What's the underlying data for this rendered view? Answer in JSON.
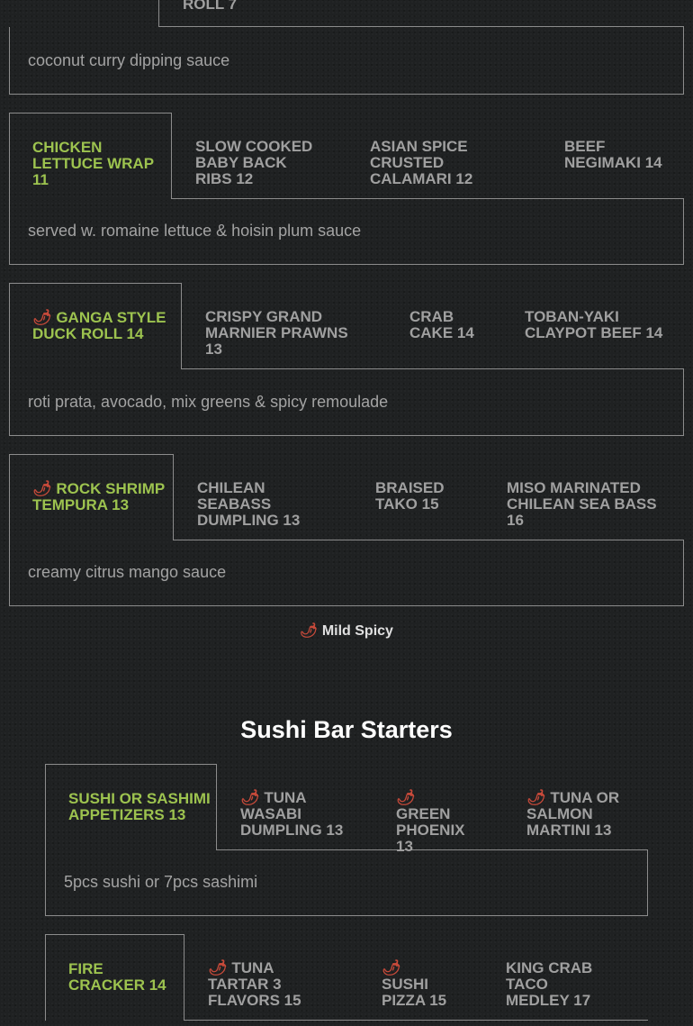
{
  "group0": {
    "tab_label": "ROLL 7",
    "description": "coconut curry dipping sauce"
  },
  "group1": {
    "tabs": [
      {
        "label": "CHICKEN LETTUCE WRAP 11",
        "active": true
      },
      {
        "label": "SLOW COOKED BABY BACK RIBS 12",
        "active": false
      },
      {
        "label": "ASIAN SPICE CRUSTED CALAMARI 12",
        "active": false
      },
      {
        "label": "BEEF NEGIMAKI 14",
        "active": false
      }
    ],
    "description": "served w. romaine lettuce & hoisin plum sauce"
  },
  "group2": {
    "tabs": [
      {
        "label": "GANGA STYLE DUCK ROLL 14",
        "active": true,
        "spicy": true
      },
      {
        "label": "CRISPY GRAND MARNIER PRAWNS 13",
        "active": false
      },
      {
        "label": "CRAB CAKE 14",
        "active": false
      },
      {
        "label": "TOBAN-YAKI CLAYPOT BEEF 14",
        "active": false
      }
    ],
    "description": "roti prata, avocado, mix greens & spicy remoulade"
  },
  "group3": {
    "tabs": [
      {
        "label": "ROCK SHRIMP TEMPURA 13",
        "active": true,
        "spicy": true
      },
      {
        "label": "CHILEAN SEABASS DUMPLING 13",
        "active": false
      },
      {
        "label": "BRAISED TAKO 15",
        "active": false
      },
      {
        "label": "MISO MARINATED CHILEAN SEA BASS 16",
        "active": false
      }
    ],
    "description": "creamy citrus mango sauce"
  },
  "legend": {
    "text": "Mild Spicy",
    "icon": "chili-pepper-icon"
  },
  "sushi_section": {
    "title": "Sushi Bar Starters"
  },
  "group4": {
    "tabs": [
      {
        "label": "SUSHI OR SASHIMI APPETIZERS 13",
        "active": true
      },
      {
        "label": "TUNA WASABI DUMPLING 13",
        "active": false,
        "spicy": true
      },
      {
        "label": "GREEN PHOENIX 13",
        "active": false,
        "spicy": true
      },
      {
        "label": "TUNA OR SALMON MARTINI 13",
        "active": false,
        "spicy": true
      }
    ],
    "description": "5pcs sushi or 7pcs sashimi"
  },
  "group5": {
    "tabs": [
      {
        "label": "FIRE CRACKER 14",
        "active": true
      },
      {
        "label": "TUNA TARTAR 3 FLAVORS 15",
        "active": false,
        "spicy": true
      },
      {
        "label": "SUSHI PIZZA 15",
        "active": false,
        "spicy": true
      },
      {
        "label": "KING CRAB TACO MEDLEY 17",
        "active": false
      }
    ]
  },
  "colors": {
    "background": "#1f2122",
    "active_tab_text": "#9dc34f",
    "tab_text": "#a0a0a0",
    "border": "#8c8c8c",
    "chili": "#c84a3a"
  }
}
